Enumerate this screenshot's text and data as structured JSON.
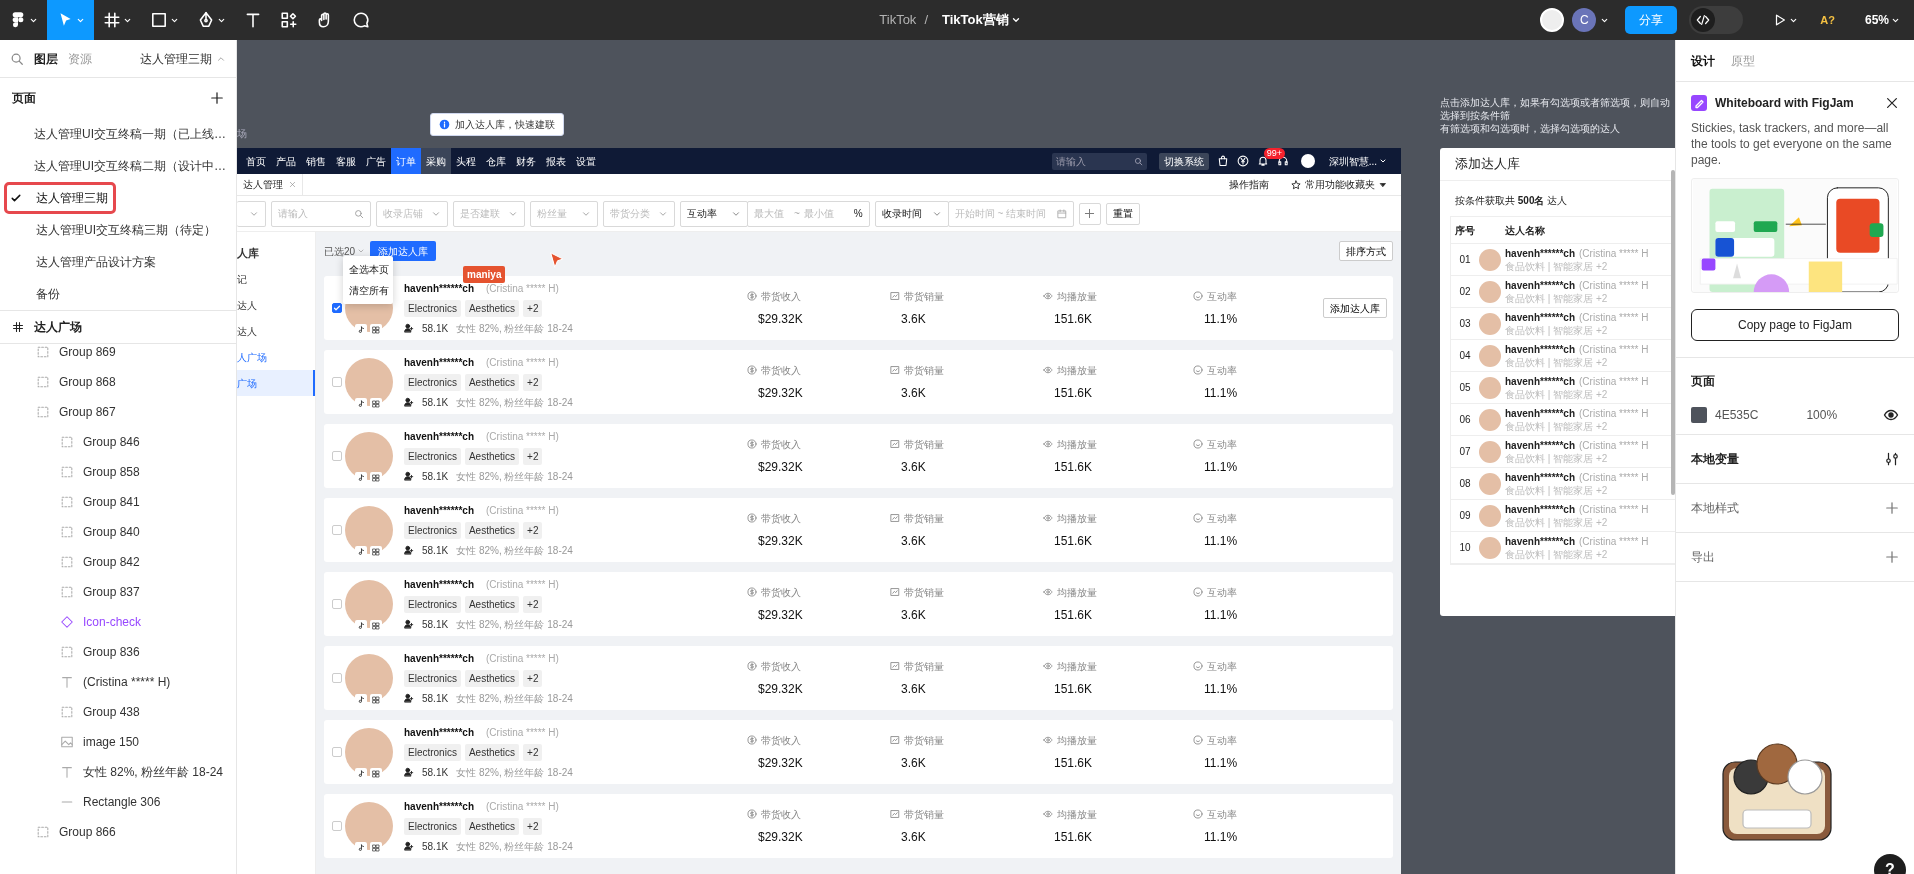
{
  "top_bar": {
    "tools": [
      {
        "kind": "logo",
        "selected": false,
        "has_menu": true
      },
      {
        "kind": "move",
        "selected": true,
        "has_menu": true
      },
      {
        "kind": "frame",
        "selected": false,
        "has_menu": true
      },
      {
        "kind": "shape",
        "selected": false,
        "has_menu": true
      },
      {
        "kind": "pen",
        "selected": false,
        "has_menu": true
      },
      {
        "kind": "text",
        "selected": false,
        "has_menu": false
      },
      {
        "kind": "resources",
        "selected": false,
        "has_menu": false
      },
      {
        "kind": "hand",
        "selected": false,
        "has_menu": false
      },
      {
        "kind": "comment",
        "selected": false,
        "has_menu": false
      }
    ],
    "project": "TikTok",
    "separator": "/",
    "file": "TikTok营销",
    "user_initial": "C",
    "share": "分享",
    "dev_mode": false,
    "assist": "A?",
    "zoom": "65%"
  },
  "left_panel": {
    "tabs": [
      {
        "label": "图层",
        "selected": true
      },
      {
        "label": "资源",
        "selected": false
      }
    ],
    "page_switcher": "达人管理三期",
    "pages_heading": "页面",
    "pages": [
      {
        "label": "达人管理UI交互终稿一期（已上线…",
        "selected": false
      },
      {
        "label": "达人管理UI交互终稿二期（设计中…",
        "selected": false
      },
      {
        "label": "达人管理三期",
        "selected": true,
        "annotated": true
      },
      {
        "label": "达人管理UI交互终稿三期（待定）",
        "selected": false
      },
      {
        "label": "达人管理产品设计方案",
        "selected": false
      },
      {
        "label": "备份",
        "selected": false
      }
    ],
    "frame": "达人广场",
    "layers": [
      {
        "kind": "group",
        "label": "Group 869"
      },
      {
        "kind": "group",
        "label": "Group 868"
      },
      {
        "kind": "group",
        "label": "Group 867",
        "children": [
          {
            "kind": "group",
            "label": "Group 846"
          },
          {
            "kind": "group",
            "label": "Group 858"
          },
          {
            "kind": "group",
            "label": "Group 841"
          },
          {
            "kind": "group",
            "label": "Group 840"
          },
          {
            "kind": "group",
            "label": "Group 842"
          },
          {
            "kind": "group",
            "label": "Group 837"
          },
          {
            "kind": "component",
            "label": "Icon-check"
          },
          {
            "kind": "group",
            "label": "Group 836"
          },
          {
            "kind": "text",
            "label": "(Cristina ***** H)"
          },
          {
            "kind": "group",
            "label": "Group 438"
          },
          {
            "kind": "image",
            "label": "image 150"
          },
          {
            "kind": "text",
            "label": "女性 82%, 粉丝年龄 18-24"
          },
          {
            "kind": "line",
            "label": "Rectangle 306"
          }
        ]
      },
      {
        "kind": "group",
        "label": "Group 866"
      }
    ]
  },
  "canvas": {
    "frame_label": "场",
    "tooltip": "加入达人库，快速建联",
    "note": [
      "点击添加达人库，如果有勾选项或者筛选项，则自动选择到按条件筛",
      "有筛选项和勾选项时，选择勾选项的达人"
    ],
    "cursor": {
      "name": "maniya"
    },
    "app": {
      "nav": [
        {
          "label": "首页",
          "selected": false,
          "hovered": false
        },
        {
          "label": "产品",
          "selected": false,
          "hovered": false
        },
        {
          "label": "销售",
          "selected": false,
          "hovered": false
        },
        {
          "label": "客服",
          "selected": false,
          "hovered": false
        },
        {
          "label": "广告",
          "selected": false,
          "hovered": false
        },
        {
          "label": "订单",
          "selected": true,
          "hovered": false
        },
        {
          "label": "采购",
          "selected": false,
          "hovered": true
        },
        {
          "label": "头程",
          "selected": false,
          "hovered": false
        },
        {
          "label": "仓库",
          "selected": false,
          "hovered": false
        },
        {
          "label": "财务",
          "selected": false,
          "hovered": false
        },
        {
          "label": "报表",
          "selected": false,
          "hovered": false
        },
        {
          "label": "设置",
          "selected": false,
          "hovered": false
        }
      ],
      "search_placeholder": "请输入",
      "switch": "切换系统",
      "badge": "99+",
      "company": "深圳智慧...",
      "tab": "达人管理",
      "guide": "操作指南",
      "favorites": "常用功能收藏夹",
      "filters": [
        {
          "kind": "select"
        },
        {
          "kind": "search",
          "placeholder": "请输入"
        },
        {
          "kind": "select",
          "placeholder": "收录店铺"
        },
        {
          "kind": "select",
          "placeholder": "是否建联"
        },
        {
          "kind": "select",
          "placeholder": "粉丝量"
        },
        {
          "kind": "select",
          "placeholder": "带货分类"
        },
        {
          "kind": "range",
          "label": "互动率",
          "min_placeholder": "最大值",
          "separator": "~",
          "max_placeholder": "最小值",
          "unit": "%"
        },
        {
          "kind": "date_range",
          "label": "收录时间",
          "placeholder": "开始时间 ~ 结束时间"
        },
        {
          "kind": "add"
        },
        {
          "kind": "button",
          "label": "重置"
        }
      ],
      "sidebar": [
        {
          "label": "人库",
          "kind": "heading"
        },
        {
          "label": "记",
          "kind": "item",
          "selected": false
        },
        {
          "label": "达人",
          "kind": "item",
          "selected": false
        },
        {
          "label": "达人",
          "kind": "item",
          "selected": false
        },
        {
          "label": "人广场",
          "kind": "group",
          "active": true
        },
        {
          "label": "广场",
          "kind": "item",
          "selected": true
        }
      ],
      "selected_count": "已选20",
      "add_button": "添加达人库",
      "menu": [
        "全选本页",
        "清空所有"
      ],
      "sort": "排序方式",
      "rows": [
        {
          "checked": true,
          "name": "havenh******ch",
          "real_name": "(Cristina ***** H)",
          "tags": [
            "Electronics",
            "Aesthetics",
            "+2"
          ],
          "fans": "58.1K",
          "audience": "女性 82%, 粉丝年龄 18-24",
          "metrics": [
            {
              "kind": "income",
              "label": "带货收入",
              "value": "$29.32K"
            },
            {
              "kind": "sales",
              "label": "带货销量",
              "value": "3.6K"
            },
            {
              "kind": "views",
              "label": "均播放量",
              "value": "151.6K"
            },
            {
              "kind": "engagement",
              "label": "互动率",
              "value": "11.1%"
            }
          ],
          "action": "添加达人库"
        },
        {
          "checked": false,
          "name": "havenh******ch",
          "real_name": "(Cristina ***** H)",
          "tags": [
            "Electronics",
            "Aesthetics",
            "+2"
          ],
          "fans": "58.1K",
          "audience": "女性 82%, 粉丝年龄 18-24",
          "metrics": [
            {
              "kind": "income",
              "label": "带货收入",
              "value": "$29.32K"
            },
            {
              "kind": "sales",
              "label": "带货销量",
              "value": "3.6K"
            },
            {
              "kind": "views",
              "label": "均播放量",
              "value": "151.6K"
            },
            {
              "kind": "engagement",
              "label": "互动率",
              "value": "11.1%"
            }
          ]
        },
        {
          "checked": false,
          "name": "havenh******ch",
          "real_name": "(Cristina ***** H)",
          "tags": [
            "Electronics",
            "Aesthetics",
            "+2"
          ],
          "fans": "58.1K",
          "audience": "女性 82%, 粉丝年龄 18-24",
          "metrics": [
            {
              "kind": "income",
              "label": "带货收入",
              "value": "$29.32K"
            },
            {
              "kind": "sales",
              "label": "带货销量",
              "value": "3.6K"
            },
            {
              "kind": "views",
              "label": "均播放量",
              "value": "151.6K"
            },
            {
              "kind": "engagement",
              "label": "互动率",
              "value": "11.1%"
            }
          ]
        },
        {
          "checked": false,
          "name": "havenh******ch",
          "real_name": "(Cristina ***** H)",
          "tags": [
            "Electronics",
            "Aesthetics",
            "+2"
          ],
          "fans": "58.1K",
          "audience": "女性 82%, 粉丝年龄 18-24",
          "metrics": [
            {
              "kind": "income",
              "label": "带货收入",
              "value": "$29.32K"
            },
            {
              "kind": "sales",
              "label": "带货销量",
              "value": "3.6K"
            },
            {
              "kind": "views",
              "label": "均播放量",
              "value": "151.6K"
            },
            {
              "kind": "engagement",
              "label": "互动率",
              "value": "11.1%"
            }
          ]
        },
        {
          "checked": false,
          "name": "havenh******ch",
          "real_name": "(Cristina ***** H)",
          "tags": [
            "Electronics",
            "Aesthetics",
            "+2"
          ],
          "fans": "58.1K",
          "audience": "女性 82%, 粉丝年龄 18-24",
          "metrics": [
            {
              "kind": "income",
              "label": "带货收入",
              "value": "$29.32K"
            },
            {
              "kind": "sales",
              "label": "带货销量",
              "value": "3.6K"
            },
            {
              "kind": "views",
              "label": "均播放量",
              "value": "151.6K"
            },
            {
              "kind": "engagement",
              "label": "互动率",
              "value": "11.1%"
            }
          ]
        },
        {
          "checked": false,
          "name": "havenh******ch",
          "real_name": "(Cristina ***** H)",
          "tags": [
            "Electronics",
            "Aesthetics",
            "+2"
          ],
          "fans": "58.1K",
          "audience": "女性 82%, 粉丝年龄 18-24",
          "metrics": [
            {
              "kind": "income",
              "label": "带货收入",
              "value": "$29.32K"
            },
            {
              "kind": "sales",
              "label": "带货销量",
              "value": "3.6K"
            },
            {
              "kind": "views",
              "label": "均播放量",
              "value": "151.6K"
            },
            {
              "kind": "engagement",
              "label": "互动率",
              "value": "11.1%"
            }
          ]
        },
        {
          "checked": false,
          "name": "havenh******ch",
          "real_name": "(Cristina ***** H)",
          "tags": [
            "Electronics",
            "Aesthetics",
            "+2"
          ],
          "fans": "58.1K",
          "audience": "女性 82%, 粉丝年龄 18-24",
          "metrics": [
            {
              "kind": "income",
              "label": "带货收入",
              "value": "$29.32K"
            },
            {
              "kind": "sales",
              "label": "带货销量",
              "value": "3.6K"
            },
            {
              "kind": "views",
              "label": "均播放量",
              "value": "151.6K"
            },
            {
              "kind": "engagement",
              "label": "互动率",
              "value": "11.1%"
            }
          ]
        },
        {
          "checked": false,
          "name": "havenh******ch",
          "real_name": "(Cristina ***** H)",
          "tags": [
            "Electronics",
            "Aesthetics",
            "+2"
          ],
          "fans": "58.1K",
          "audience": "女性 82%, 粉丝年龄 18-24",
          "metrics": [
            {
              "kind": "income",
              "label": "带货收入",
              "value": "$29.32K"
            },
            {
              "kind": "sales",
              "label": "带货销量",
              "value": "3.6K"
            },
            {
              "kind": "views",
              "label": "均播放量",
              "value": "151.6K"
            },
            {
              "kind": "engagement",
              "label": "互动率",
              "value": "11.1%"
            }
          ]
        }
      ]
    },
    "side_panel": {
      "title": "添加达人库",
      "summary": "按条件获取共 **500名** 达人",
      "columns": [
        "序号",
        "达人名称"
      ],
      "rows": [
        {
          "index": "01",
          "name": "havenh******ch",
          "real_name": "(Cristina ***** H",
          "categories": "食品饮料 | 智能家居 +2"
        },
        {
          "index": "02",
          "name": "havenh******ch",
          "real_name": "(Cristina ***** H",
          "categories": "食品饮料 | 智能家居 +2"
        },
        {
          "index": "03",
          "name": "havenh******ch",
          "real_name": "(Cristina ***** H",
          "categories": "食品饮料 | 智能家居 +2"
        },
        {
          "index": "04",
          "name": "havenh******ch",
          "real_name": "(Cristina ***** H",
          "categories": "食品饮料 | 智能家居 +2"
        },
        {
          "index": "05",
          "name": "havenh******ch",
          "real_name": "(Cristina ***** H",
          "categories": "食品饮料 | 智能家居 +2"
        },
        {
          "index": "06",
          "name": "havenh******ch",
          "real_name": "(Cristina ***** H",
          "categories": "食品饮料 | 智能家居 +2"
        },
        {
          "index": "07",
          "name": "havenh******ch",
          "real_name": "(Cristina ***** H",
          "categories": "食品饮料 | 智能家居 +2"
        },
        {
          "index": "08",
          "name": "havenh******ch",
          "real_name": "(Cristina ***** H",
          "categories": "食品饮料 | 智能家居 +2"
        },
        {
          "index": "09",
          "name": "havenh******ch",
          "real_name": "(Cristina ***** H",
          "categories": "食品饮料 | 智能家居 +2"
        },
        {
          "index": "10",
          "name": "havenh******ch",
          "real_name": "(Cristina ***** H",
          "categories": "食品饮料 | 智能家居 +2"
        }
      ]
    }
  },
  "right_panel": {
    "tabs": [
      {
        "label": "设计",
        "selected": true
      },
      {
        "label": "原型",
        "selected": false
      }
    ],
    "promo": {
      "title": "Whiteboard with FigJam",
      "text": "Stickies, task trackers, and more—all the tools to get everyone on the same page.",
      "button": "Copy page to FigJam"
    },
    "page": {
      "heading": "页面",
      "color": "#4e535c",
      "hex": "4E535C",
      "opacity": "100%"
    },
    "sections": [
      {
        "label": "本地变量",
        "kind": "variables"
      },
      {
        "label": "本地样式",
        "kind": "add"
      },
      {
        "label": "导出",
        "kind": "add"
      }
    ]
  },
  "help": "?"
}
